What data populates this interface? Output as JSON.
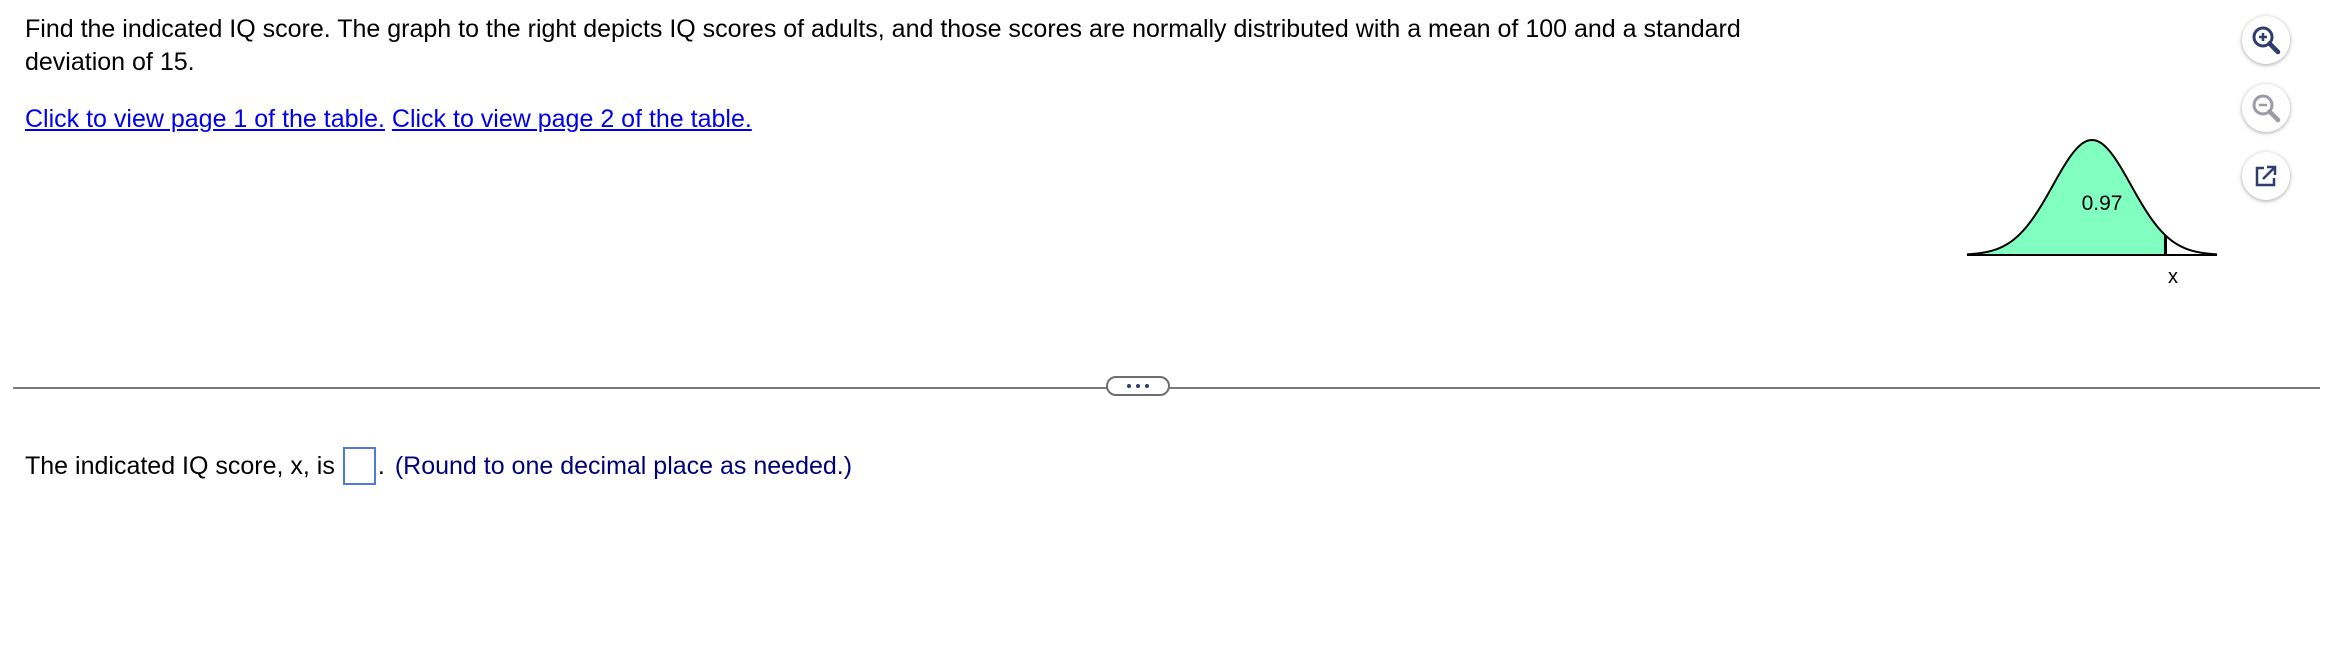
{
  "question": {
    "text": "Find the indicated IQ score. The graph to the right depicts IQ scores of adults, and those scores are normally distributed with a mean of 100 and a standard deviation of 15."
  },
  "links": {
    "page1": "Click to view page 1 of the table.",
    "page2": "Click to view page 2 of the table."
  },
  "graph": {
    "area_label": "0.97",
    "x_label": "x",
    "fill_color": "#80ffc0",
    "shaded_area": 0.97,
    "mean": 100,
    "std_dev": 15
  },
  "toolbar": {
    "zoom_in_icon": "zoom-in-icon",
    "zoom_out_icon": "zoom-out-icon",
    "popout_icon": "external-link-icon"
  },
  "answer": {
    "prefix": "The indicated IQ score, x, is",
    "input_value": "",
    "suffix": ".",
    "hint": "(Round to one decimal place as needed.)"
  },
  "colors": {
    "link": "#0000ee",
    "hint": "#00007a",
    "input_border": "#4c7bd6",
    "divider": "#7a7a7a",
    "icon": "#2d3d6e"
  }
}
